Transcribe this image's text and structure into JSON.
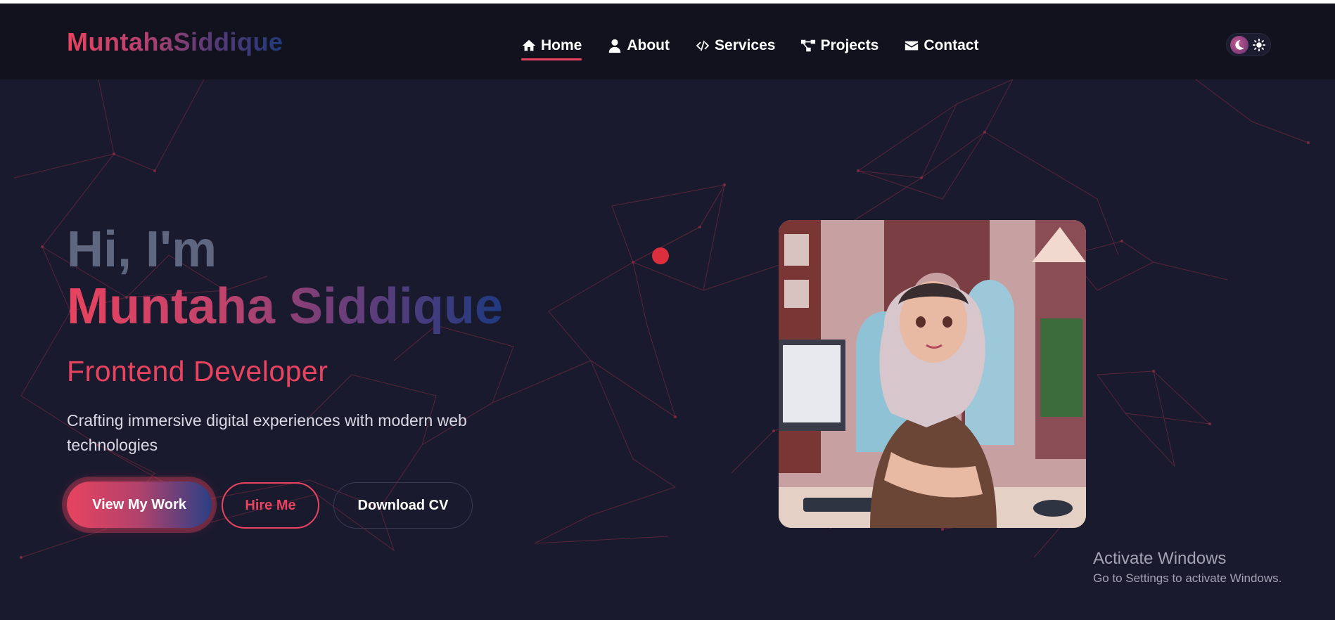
{
  "header": {
    "logo": "MuntahaSiddique",
    "nav": [
      {
        "label": "Home",
        "icon": "home-icon",
        "active": true
      },
      {
        "label": "About",
        "icon": "user-icon",
        "active": false
      },
      {
        "label": "Services",
        "icon": "code-icon",
        "active": false
      },
      {
        "label": "Projects",
        "icon": "project-diagram-icon",
        "active": false
      },
      {
        "label": "Contact",
        "icon": "envelope-icon",
        "active": false
      }
    ],
    "theme_toggle": {
      "left_icon": "moon-icon",
      "right_icon": "sun-icon",
      "mode": "dark"
    }
  },
  "hero": {
    "greeting": "Hi, I'm",
    "name": "Muntaha Siddique",
    "role": "Frontend Developer",
    "description": "Crafting immersive digital experiences with modern web technologies",
    "buttons": {
      "work": "View My Work",
      "hire": "Hire Me",
      "cv": "Download CV"
    },
    "portrait_alt": "portrait-illustration"
  },
  "watermark": {
    "title": "Activate Windows",
    "subtitle": "Go to Settings to activate Windows."
  },
  "colors": {
    "background": "#1a1a2e",
    "navbar": "#12121f",
    "accent": "#e8435f",
    "accent_blue": "#1f3a80"
  }
}
